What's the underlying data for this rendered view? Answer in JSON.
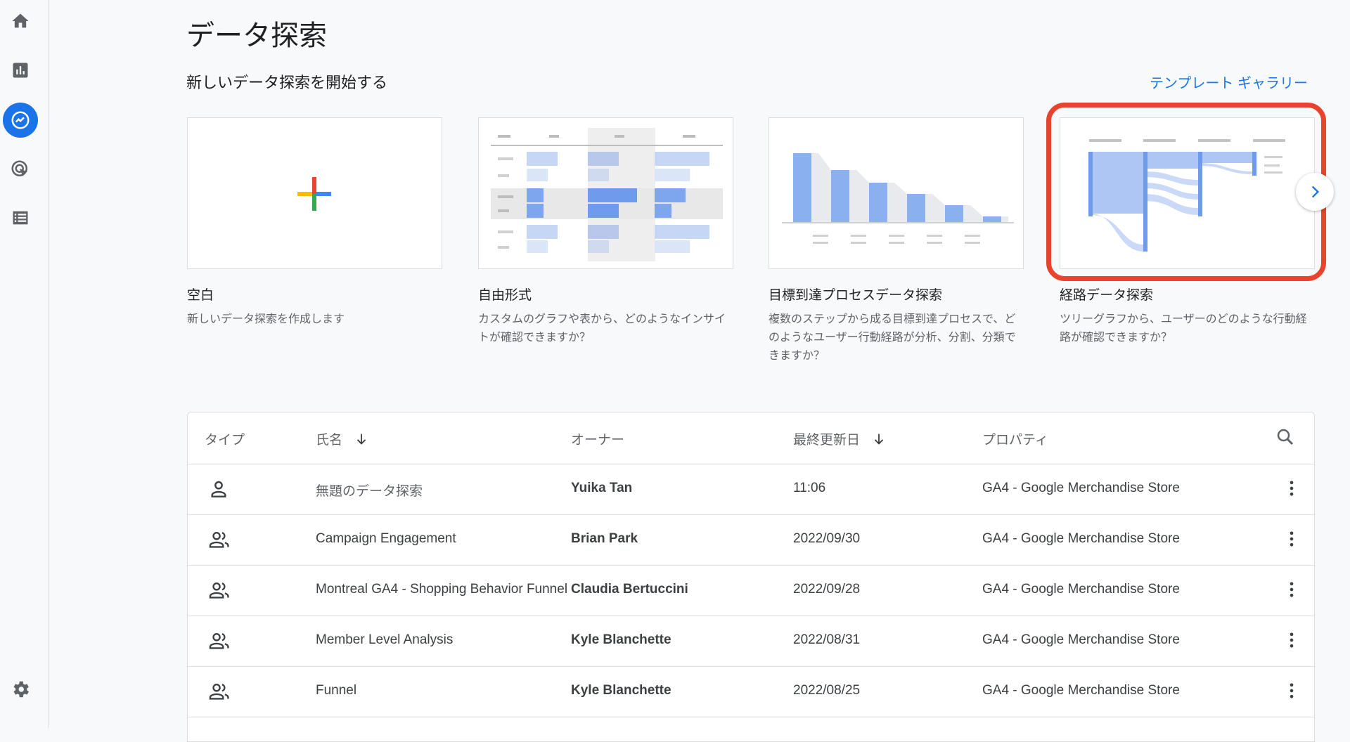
{
  "page_title": "データ探索",
  "section_title": "新しいデータ探索を開始する",
  "gallery_link": "テンプレート ギャラリー",
  "nav": {
    "items": [
      {
        "icon": "home-icon"
      },
      {
        "icon": "reports-icon"
      },
      {
        "icon": "explore-icon",
        "active": true
      },
      {
        "icon": "advertising-icon"
      },
      {
        "icon": "configure-icon"
      }
    ],
    "settings_icon": "settings-gear-icon"
  },
  "templates": [
    {
      "title": "空白",
      "description": "新しいデータ探索を作成します"
    },
    {
      "title": "自由形式",
      "description": "カスタムのグラフや表から、どのようなインサイトが確認できますか？"
    },
    {
      "title": "目標到達プロセスデータ探索",
      "description": "複数のステップから成る目標到達プロセスで、どのようなユーザー行動経路が分析、分割、分類できますか？"
    },
    {
      "title": "経路データ探索",
      "description": "ツリーグラフから、ユーザーのどのような行動経路が確認できますか？",
      "highlighted": true
    }
  ],
  "table": {
    "headers": {
      "type": "タイプ",
      "name": "氏名",
      "owner": "オーナー",
      "updated": "最終更新日",
      "property": "プロパティ"
    },
    "rows": [
      {
        "type_icon": "person-icon",
        "name": "無題のデータ探索",
        "owner": "Yuika Tan",
        "updated": "11:06",
        "property": "GA4 - Google Merchandise Store"
      },
      {
        "type_icon": "people-icon",
        "name": "Campaign Engagement",
        "owner": "Brian Park",
        "updated": "2022/09/30",
        "property": "GA4 - Google Merchandise Store"
      },
      {
        "type_icon": "people-icon",
        "name": "Montreal GA4 - Shopping Behavior Funnel",
        "owner": "Claudia Bertuccini",
        "updated": "2022/09/28",
        "property": "GA4 - Google Merchandise Store"
      },
      {
        "type_icon": "people-icon",
        "name": "Member Level Analysis",
        "owner": "Kyle Blanchette",
        "updated": "2022/08/31",
        "property": "GA4 - Google Merchandise Store"
      },
      {
        "type_icon": "people-icon",
        "name": "Funnel",
        "owner": "Kyle Blanchette",
        "updated": "2022/08/25",
        "property": "GA4 - Google Merchandise Store"
      }
    ]
  },
  "colors": {
    "accent": "#1a73e8",
    "highlight": "#e8432e"
  }
}
